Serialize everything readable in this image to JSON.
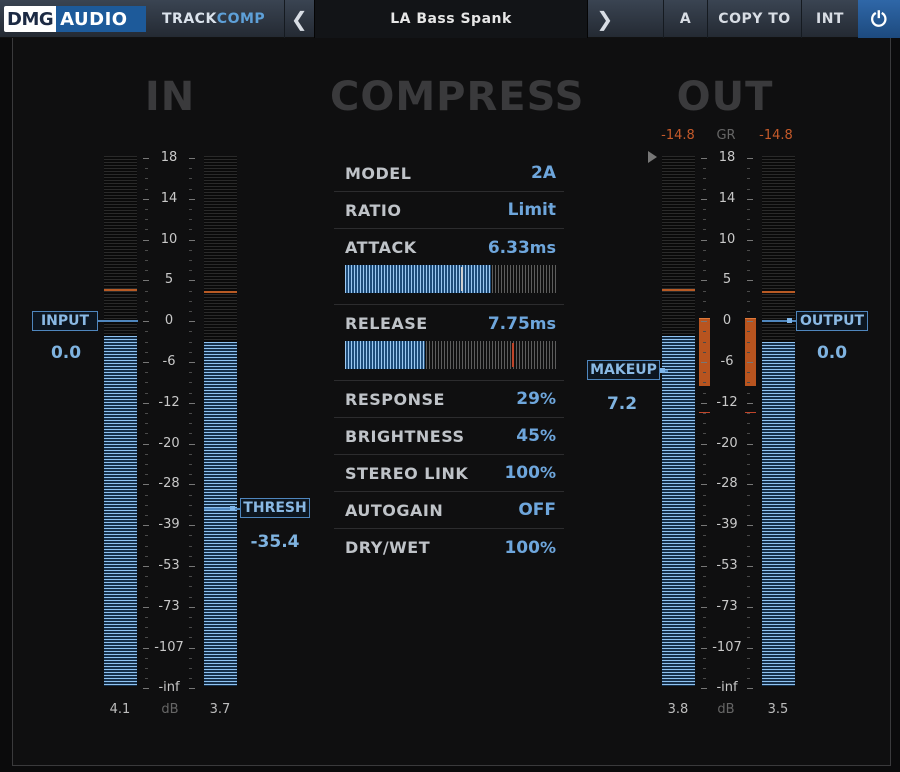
{
  "topbar": {
    "logo_dmg": "DMG",
    "logo_audio": "AUDIO",
    "product_track": "TRACK",
    "product_comp": "COMP",
    "prev_glyph": "❮",
    "preset_name": "LA Bass Spank",
    "next_glyph": "❯",
    "a_label": "A",
    "copy_to_label": "COPY TO",
    "int_label": "INT",
    "power_glyph": "⏻",
    "icons": {
      "prev": "chevron-left-icon",
      "next": "chevron-right-icon",
      "power": "power-icon"
    }
  },
  "sections": {
    "in": "IN",
    "compress": "COMPRESS",
    "out": "OUT"
  },
  "scale": [
    "18",
    "14",
    "10",
    "5",
    "0",
    "-6",
    "-12",
    "-20",
    "-28",
    "-39",
    "-53",
    "-73",
    "-107",
    "-inf"
  ],
  "in_section": {
    "input_label": "INPUT",
    "input_value": "0.0",
    "thresh_label": "THRESH",
    "thresh_value": "-35.4",
    "meter_left_readout": "4.1",
    "meter_right_readout": "3.7",
    "unit_label": "dB",
    "meter_left_level": 0.66,
    "meter_right_level": 0.65
  },
  "out_section": {
    "gr_left": "-14.8",
    "gr_label": "GR",
    "gr_right": "-14.8",
    "makeup_label": "MAKEUP",
    "makeup_value": "7.2",
    "output_label": "OUTPUT",
    "output_value": "0.0",
    "meter_left_readout": "3.8",
    "meter_right_readout": "3.5",
    "unit_label": "dB",
    "meter_left_level": 0.66,
    "meter_right_level": 0.65
  },
  "params": [
    {
      "name": "MODEL",
      "value": "2A",
      "unit": ""
    },
    {
      "name": "RATIO",
      "value": "Limit",
      "unit": ""
    },
    {
      "name": "ATTACK",
      "value": "6.33",
      "unit": "ms",
      "slider_fraction": 0.69
    },
    {
      "name": "RELEASE",
      "value": "7.75",
      "unit": "ms",
      "slider_fraction": 0.38
    },
    {
      "name": "RESPONSE",
      "value": "29",
      "unit": "%"
    },
    {
      "name": "BRIGHTNESS",
      "value": "45",
      "unit": "%"
    },
    {
      "name": "STEREO LINK",
      "value": "100",
      "unit": "%"
    },
    {
      "name": "AUTOGAIN",
      "value": "OFF",
      "unit": ""
    },
    {
      "name": "DRY/WET",
      "value": "100",
      "unit": "%"
    }
  ],
  "colors": {
    "accent": "#6ea6dc",
    "meter_fill": "#8fc2f0",
    "gr": "#c55a2a",
    "power_bg": "#2f67a8"
  }
}
